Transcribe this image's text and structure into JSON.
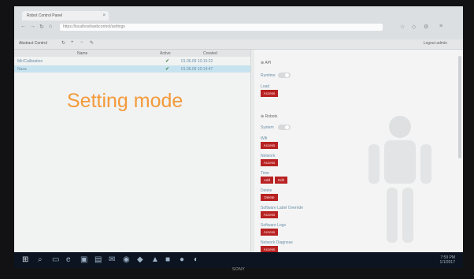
{
  "overlay_text": "Setting mode",
  "browser": {
    "tab_title": "Robot Control Panel",
    "url": "https://localhost/webcontrol/settings"
  },
  "app_toolbar": {
    "label": "Abstract Control",
    "right_label": "Logout admin"
  },
  "table": {
    "columns": [
      "Name",
      "Active",
      "Created"
    ],
    "rows": [
      {
        "name": "Mir/Calibration",
        "active": true,
        "created": "01.06.09 10:15:22",
        "selected": false
      },
      {
        "name": "Nasa",
        "active": true,
        "created": "01.06.09 10:14:47",
        "selected": true
      }
    ]
  },
  "right_panel": {
    "sections": [
      {
        "title": "API",
        "items": [
          {
            "type": "toggle",
            "label": "Runtime"
          },
          {
            "type": "button",
            "label": "Load",
            "button": "Access"
          }
        ]
      },
      {
        "title": "Robots",
        "items": [
          {
            "type": "toggle",
            "label": "System"
          },
          {
            "type": "button",
            "label": "Wifi",
            "button": "Access"
          },
          {
            "type": "button",
            "label": "Network",
            "button": "Access"
          },
          {
            "type": "button2",
            "label": "Time",
            "buttons": [
              "Add",
              "Edit"
            ]
          },
          {
            "type": "button",
            "label": "Delete",
            "button": "Delete"
          },
          {
            "type": "button",
            "label": "Software Label Override",
            "button": "Access"
          },
          {
            "type": "button",
            "label": "Software Logs",
            "button": "Access"
          },
          {
            "type": "button",
            "label": "Network Diagnose",
            "button": "Access"
          }
        ]
      }
    ]
  },
  "taskbar": {
    "time": "7:59 PM",
    "date": "1/1/2017"
  },
  "monitor_brand": "SONY",
  "colors": {
    "overlay": "#f39a3a",
    "button": "#b82222",
    "selected_row": "#c7e3ef"
  }
}
